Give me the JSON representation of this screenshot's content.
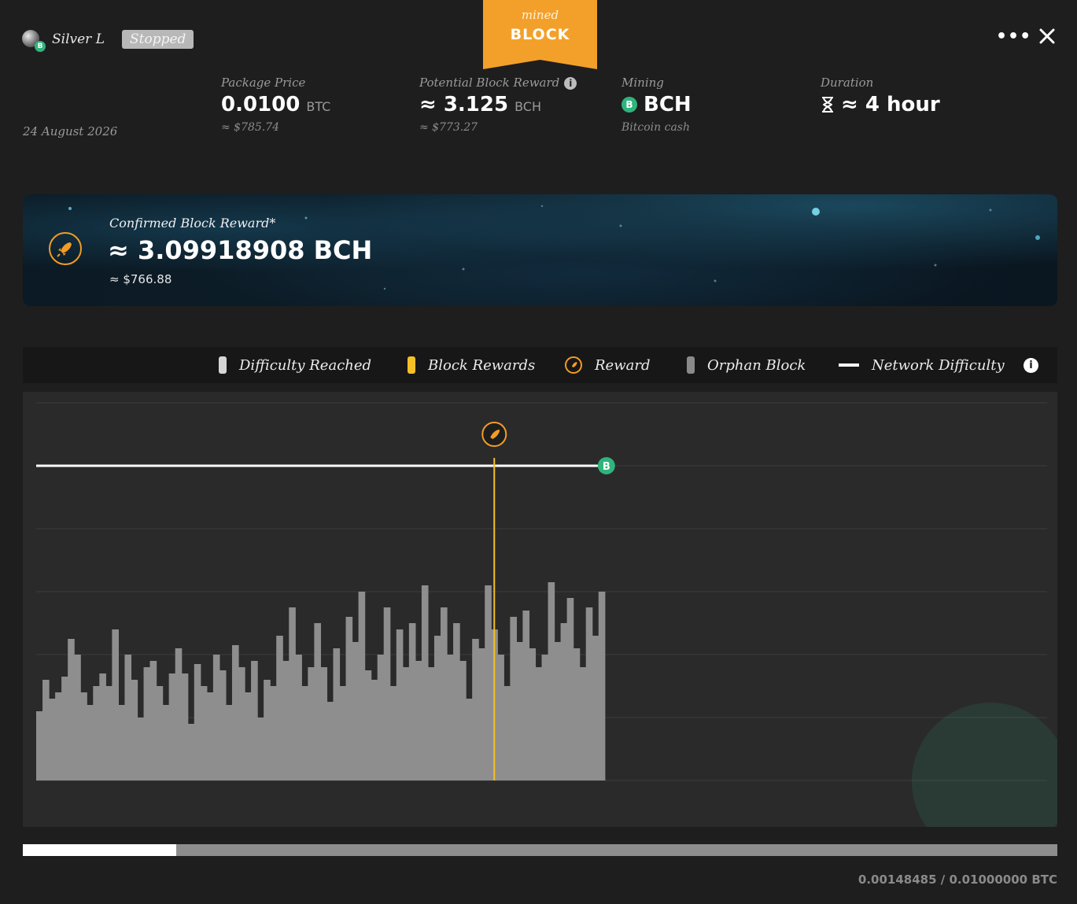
{
  "header": {
    "username": "Silver L",
    "status": "Stopped",
    "banner_top": "mined",
    "banner_bottom": "BLOCK",
    "menu_icon": "ellipsis-icon",
    "close_icon": "close-icon",
    "date": "24 August 2026"
  },
  "stats": {
    "package_price": {
      "label": "Package Price",
      "value": "0.0100",
      "unit": "BTC",
      "sub": "≈ $785.74"
    },
    "potential_reward": {
      "label": "Potential Block Reward",
      "value": "≈ 3.125",
      "unit": "BCH",
      "sub": "≈ $773.27"
    },
    "mining": {
      "label": "Mining",
      "coin_symbol": "B",
      "value": "BCH",
      "sub": "Bitcoin cash"
    },
    "duration": {
      "label": "Duration",
      "icon": "hourglass-icon",
      "value": "≈ 4 hour"
    }
  },
  "confirmed": {
    "label": "Confirmed Block Reward*",
    "value": "≈ 3.09918908 BCH",
    "usd": "≈ $766.88"
  },
  "legend": {
    "difficulty_reached": "Difficulty Reached",
    "block_rewards": "Block Rewards",
    "reward": "Reward",
    "orphan_block": "Orphan Block",
    "network_difficulty": "Network Difficulty",
    "info_symbol": "i"
  },
  "colors": {
    "accent_orange": "#f39c25",
    "bch_green": "#2fb47c",
    "block_reward_yellow": "#f5c026",
    "difficulty_gray": "#8e8e8e"
  },
  "chart_data": {
    "type": "bar",
    "n_total": 160,
    "values": [
      0.22,
      0.32,
      0.26,
      0.28,
      0.33,
      0.45,
      0.4,
      0.28,
      0.24,
      0.3,
      0.34,
      0.3,
      0.48,
      0.24,
      0.4,
      0.32,
      0.2,
      0.36,
      0.38,
      0.3,
      0.24,
      0.34,
      0.42,
      0.34,
      0.18,
      0.37,
      0.3,
      0.28,
      0.4,
      0.35,
      0.24,
      0.43,
      0.36,
      0.28,
      0.38,
      0.2,
      0.32,
      0.3,
      0.46,
      0.38,
      0.55,
      0.4,
      0.3,
      0.36,
      0.5,
      0.36,
      0.25,
      0.42,
      0.3,
      0.52,
      0.44,
      0.6,
      0.35,
      0.32,
      0.4,
      0.55,
      0.3,
      0.48,
      0.36,
      0.5,
      0.38,
      0.62,
      0.36,
      0.46,
      0.55,
      0.4,
      0.5,
      0.38,
      0.26,
      0.45,
      0.42,
      0.62,
      0.48,
      0.4,
      0.3,
      0.52,
      0.44,
      0.54,
      0.42,
      0.36,
      0.4,
      0.63,
      0.44,
      0.5,
      0.58,
      0.42,
      0.36,
      0.55,
      0.46,
      0.6
    ],
    "network_difficulty": 1.0,
    "block_reward_index": 72,
    "ylim": [
      0,
      1.2
    ],
    "grid": true
  },
  "progress": {
    "fraction": 0.148485,
    "text": "0.00148485 / 0.01000000 BTC"
  }
}
